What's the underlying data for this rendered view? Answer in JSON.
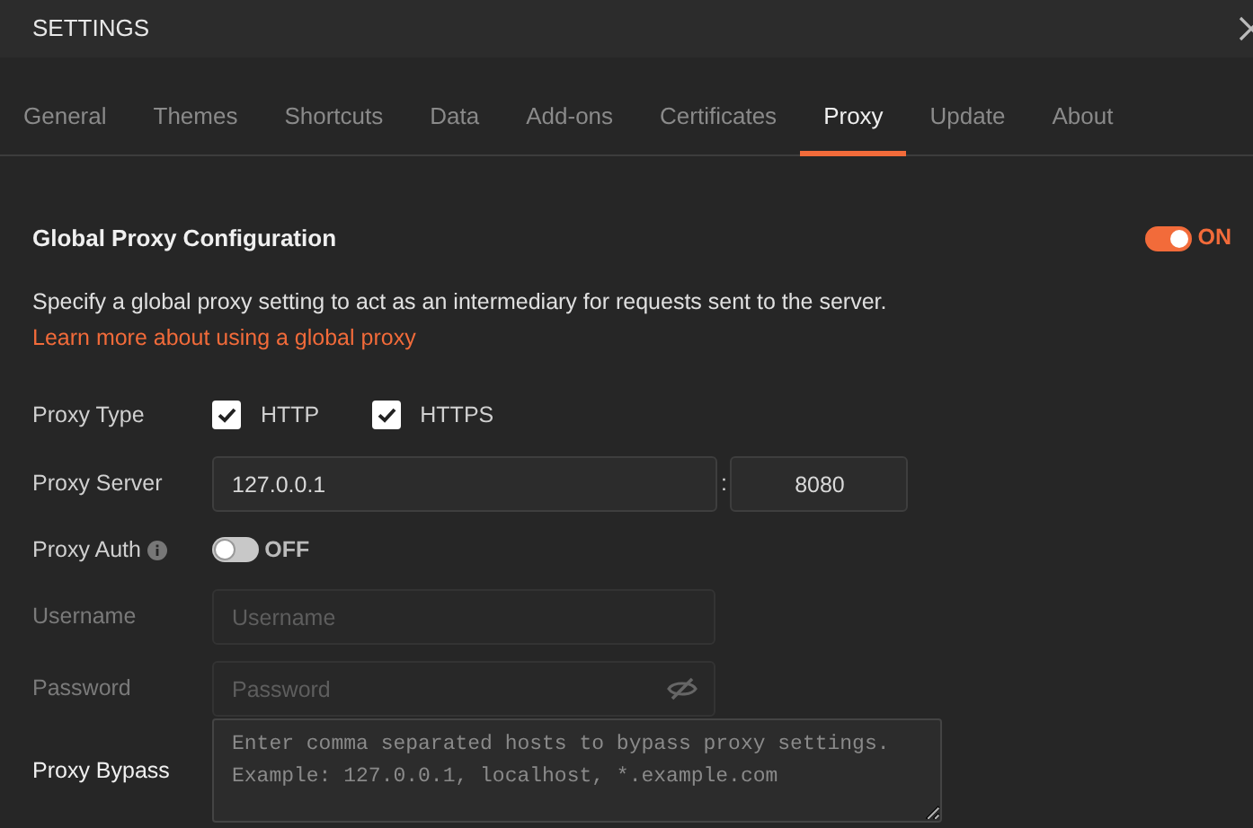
{
  "window": {
    "title": "SETTINGS"
  },
  "tabs": [
    {
      "label": "General",
      "selected": false
    },
    {
      "label": "Themes",
      "selected": false
    },
    {
      "label": "Shortcuts",
      "selected": false
    },
    {
      "label": "Data",
      "selected": false
    },
    {
      "label": "Add-ons",
      "selected": false
    },
    {
      "label": "Certificates",
      "selected": false
    },
    {
      "label": "Proxy",
      "selected": true
    },
    {
      "label": "Update",
      "selected": false
    },
    {
      "label": "About",
      "selected": false
    }
  ],
  "section": {
    "title": "Global Proxy Configuration",
    "toggle": {
      "on": true,
      "label": "ON"
    },
    "description": "Specify a global proxy setting to act as an intermediary for requests sent to the server.",
    "link": "Learn more about using a global proxy"
  },
  "proxy_type": {
    "label": "Proxy Type",
    "options": [
      {
        "label": "HTTP",
        "checked": true
      },
      {
        "label": "HTTPS",
        "checked": true
      }
    ]
  },
  "proxy_server": {
    "label": "Proxy Server",
    "host": "127.0.0.1",
    "separator": ":",
    "port": "8080"
  },
  "proxy_auth": {
    "label": "Proxy Auth",
    "toggle": {
      "on": false,
      "label": "OFF"
    }
  },
  "username": {
    "label": "Username",
    "placeholder": "Username",
    "disabled": true
  },
  "password": {
    "label": "Password",
    "placeholder": "Password",
    "disabled": true
  },
  "proxy_bypass": {
    "label": "Proxy Bypass",
    "placeholder": "Enter comma separated hosts to bypass proxy settings.\nExample: 127.0.0.1, localhost, *.example.com"
  }
}
